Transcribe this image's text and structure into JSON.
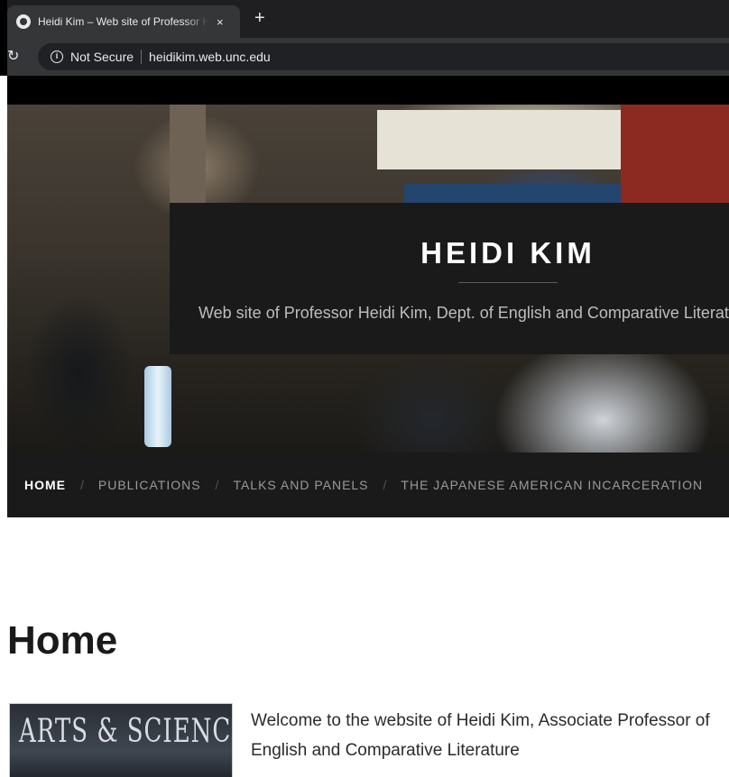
{
  "browser": {
    "tab_title": "Heidi Kim – Web site of Professor Heidi Kim",
    "tab_close": "×",
    "new_tab": "+",
    "reload": "↻",
    "security_label": "Not Secure",
    "url": "heidikim.web.unc.edu"
  },
  "site": {
    "title": "HEIDI KIM",
    "tagline": "Web site of Professor Heidi Kim, Dept. of English and Comparative Literature"
  },
  "nav": {
    "separator": "/",
    "items": [
      {
        "label": "HOME",
        "active": true
      },
      {
        "label": "PUBLICATIONS",
        "active": false
      },
      {
        "label": "TALKS AND PANELS",
        "active": false
      },
      {
        "label": "THE JAPANESE AMERICAN INCARCERATION",
        "active": false
      }
    ]
  },
  "main": {
    "heading": "Home",
    "thumbnail_text": "ARTS & SCIENCES",
    "intro": "Welcome to the website of Heidi Kim, Associate Professor of English and Comparative Literature"
  }
}
